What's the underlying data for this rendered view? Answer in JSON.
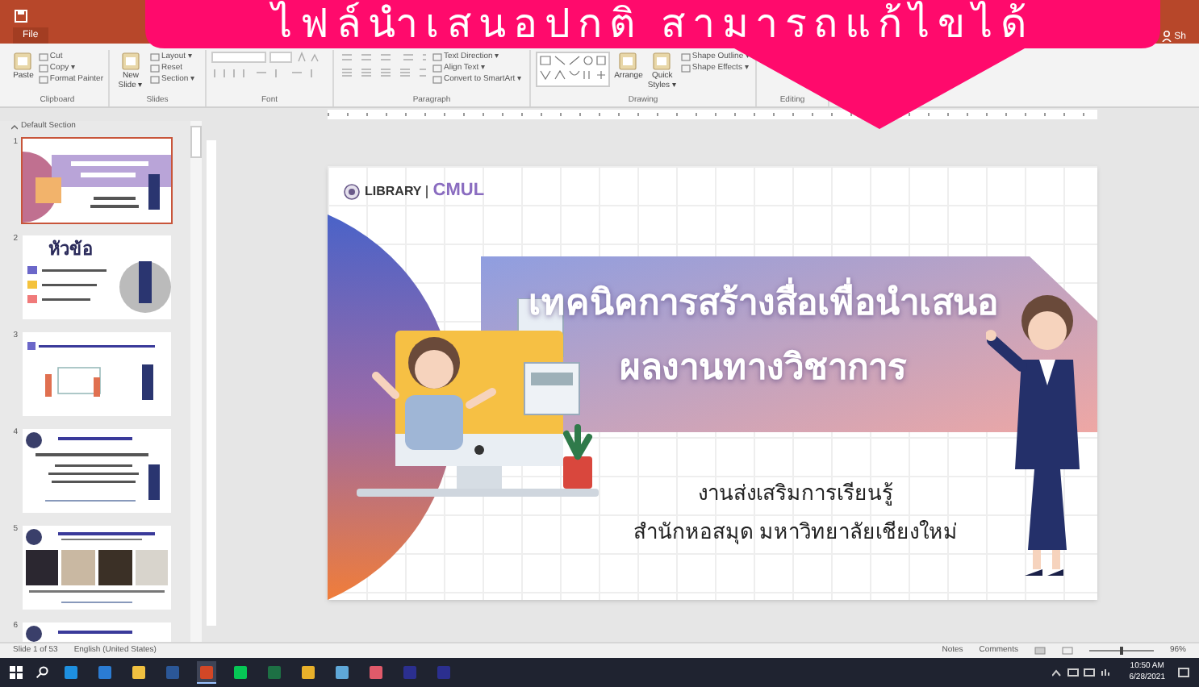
{
  "banner": {
    "text": "ไฟล์นำเสนอปกติ สามารถแก้ไขได้"
  },
  "title_bar": {
    "file_tab": "File",
    "share": "Sh"
  },
  "ribbon": {
    "groups": [
      {
        "label": "Clipboard",
        "kind": "clipboard",
        "items": [
          {
            "kind": "large",
            "label": "Paste"
          },
          {
            "kind": "small",
            "label": "Cut"
          },
          {
            "kind": "small",
            "label": "Copy ▾"
          },
          {
            "kind": "small",
            "label": "Format Painter"
          }
        ]
      },
      {
        "label": "Slides",
        "kind": "slides",
        "items": [
          {
            "kind": "large",
            "label": "New Slide ▾"
          },
          {
            "kind": "small",
            "label": "Layout ▾"
          },
          {
            "kind": "small",
            "label": "Reset"
          },
          {
            "kind": "small",
            "label": "Section ▾"
          }
        ]
      },
      {
        "label": "Font",
        "kind": "font"
      },
      {
        "label": "Paragraph",
        "kind": "paragraph",
        "items": [
          {
            "kind": "small",
            "label": "Text Direction ▾"
          },
          {
            "kind": "small",
            "label": "Align Text ▾"
          },
          {
            "kind": "small",
            "label": "Convert to SmartArt ▾"
          }
        ]
      },
      {
        "label": "Drawing",
        "kind": "drawing",
        "items": [
          {
            "kind": "large",
            "label": "Arrange"
          },
          {
            "kind": "large",
            "label": "Quick Styles ▾"
          },
          {
            "kind": "small",
            "label": "Shape Outline ▾"
          },
          {
            "kind": "small",
            "label": "Shape Effects ▾"
          }
        ]
      },
      {
        "label": "Editing",
        "kind": "editing"
      }
    ]
  },
  "slides_panel": {
    "section": "Default Section",
    "slides": [
      {
        "number": "1",
        "kind": "title",
        "selected": true
      },
      {
        "number": "2",
        "kind": "agenda",
        "selected": false,
        "title": "หัวข้อ"
      },
      {
        "number": "3",
        "kind": "section",
        "selected": false
      },
      {
        "number": "4",
        "kind": "content",
        "selected": false
      },
      {
        "number": "5",
        "kind": "photos",
        "selected": false
      },
      {
        "number": "6",
        "kind": "content",
        "selected": false
      }
    ]
  },
  "slide": {
    "logo_word": "LIBRARY",
    "logo_mark": "CMUL",
    "title_lines": [
      "เทคนิคการสร้างสื่อเพื่อนำเสนอ",
      "ผลงานทางวิชาการ"
    ],
    "subtitle_lines": [
      "งานส่งเสริมการเรียนรู้",
      "สำนักหอสมุด มหาวิทยาลัยเชียงใหม่"
    ]
  },
  "status_bar": {
    "slide_count": "Slide 1 of 53",
    "language": "English (United States)",
    "notes": "Notes",
    "comments": "Comments",
    "zoom": {
      "level": 0.5
    },
    "zoom_percent": "96%"
  },
  "taskbar": {
    "apps": [
      {
        "color": "#1e90e0",
        "active": false
      },
      {
        "color": "#2b7cd3",
        "active": false
      },
      {
        "color": "#f0c040",
        "active": false
      },
      {
        "color": "#2b5797",
        "active": false
      },
      {
        "color": "#d24726",
        "active": true
      },
      {
        "color": "#06c755",
        "active": false
      },
      {
        "color": "#1d7044",
        "active": false
      },
      {
        "color": "#e8b02a",
        "active": false
      },
      {
        "color": "#5fa8d8",
        "active": false
      },
      {
        "color": "#e05a6a",
        "active": false
      },
      {
        "color": "#2b2f8f",
        "active": false
      },
      {
        "color": "#2b2f8f",
        "active": false
      }
    ],
    "time": "10:50 AM",
    "date": "6/28/2021"
  }
}
